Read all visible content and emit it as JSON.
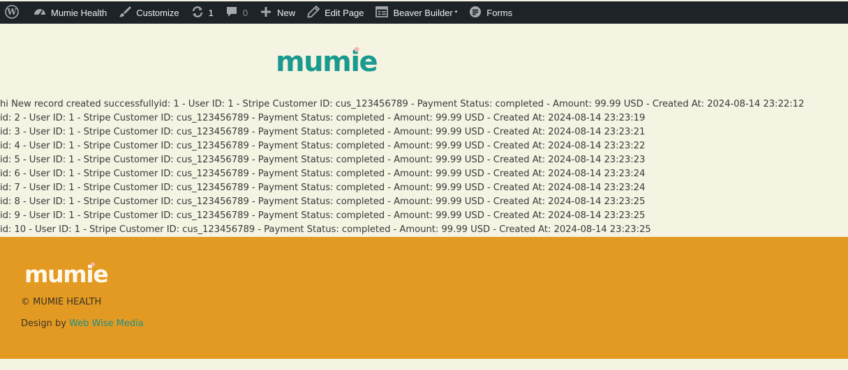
{
  "admin_bar": {
    "site_name": "Mumie Health",
    "customize": "Customize",
    "updates_count": "1",
    "comments_count": "0",
    "new": "New",
    "edit_page": "Edit Page",
    "beaver_builder": "Beaver Builder",
    "beaver_dot": "•",
    "forms": "Forms"
  },
  "brand": {
    "logo_text": "mumie",
    "logo_color": "#1a9a8e",
    "dot_color": "#f2b5b0",
    "footer_logo_color": "#fff8ea"
  },
  "records": [
    "hi New record created successfullyid: 1 - User ID: 1 - Stripe Customer ID: cus_123456789 - Payment Status: completed - Amount: 99.99 USD - Created At: 2024-08-14 23:22:12",
    "id: 2 - User ID: 1 - Stripe Customer ID: cus_123456789 - Payment Status: completed - Amount: 99.99 USD - Created At: 2024-08-14 23:23:19",
    "id: 3 - User ID: 1 - Stripe Customer ID: cus_123456789 - Payment Status: completed - Amount: 99.99 USD - Created At: 2024-08-14 23:23:21",
    "id: 4 - User ID: 1 - Stripe Customer ID: cus_123456789 - Payment Status: completed - Amount: 99.99 USD - Created At: 2024-08-14 23:23:22",
    "id: 5 - User ID: 1 - Stripe Customer ID: cus_123456789 - Payment Status: completed - Amount: 99.99 USD - Created At: 2024-08-14 23:23:23",
    "id: 6 - User ID: 1 - Stripe Customer ID: cus_123456789 - Payment Status: completed - Amount: 99.99 USD - Created At: 2024-08-14 23:23:24",
    "id: 7 - User ID: 1 - Stripe Customer ID: cus_123456789 - Payment Status: completed - Amount: 99.99 USD - Created At: 2024-08-14 23:23:24",
    "id: 8 - User ID: 1 - Stripe Customer ID: cus_123456789 - Payment Status: completed - Amount: 99.99 USD - Created At: 2024-08-14 23:23:25",
    "id: 9 - User ID: 1 - Stripe Customer ID: cus_123456789 - Payment Status: completed - Amount: 99.99 USD - Created At: 2024-08-14 23:23:25",
    "id: 10 - User ID: 1 - Stripe Customer ID: cus_123456789 - Payment Status: completed - Amount: 99.99 USD - Created At: 2024-08-14 23:23:25"
  ],
  "footer": {
    "copyright": "© MUMIE HEALTH",
    "credit_prefix": "Design by ",
    "credit_link": "Web Wise Media"
  }
}
